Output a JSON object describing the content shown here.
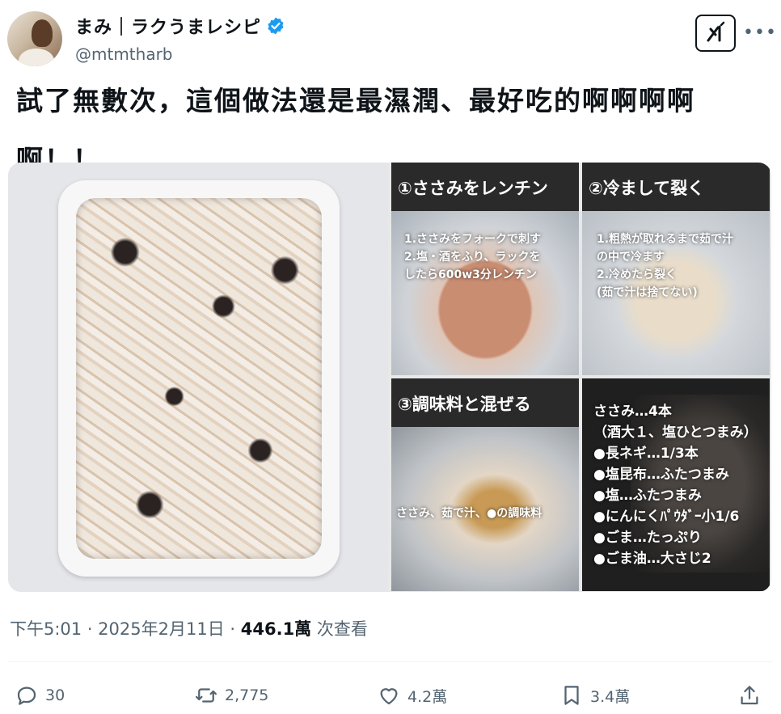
{
  "author": {
    "display_name": "まみ｜ラクうまレシピ",
    "handle": "@mtmtharb"
  },
  "tweet": {
    "text": "試了無數次，這個做法還是最濕潤、最好吃的啊啊啊啊啊！！"
  },
  "media": {
    "panels": [
      {
        "title": "①ささみをレンチン",
        "text": "1.ささみをフォークで刺す\n2.塩・酒をふり、ラックを\nしたら600w3分レンチン"
      },
      {
        "title": "②冷まして裂く",
        "text": "1.粗熱が取れるまで茹で汁\nの中で冷ます\n2.冷めたら裂く\n(茹で汁は捨てない)"
      },
      {
        "title": "③調味料と混ぜる",
        "text": "ささみ、茹で汁、●の調味料"
      },
      {
        "title": "",
        "text": "ささみ…4本\n（酒大１、塩ひとつまみ）\n●長ネギ…1/3本\n●塩昆布…ふたつまみ\n●塩…ふたつまみ\n●にんにくﾊﾟｳﾀﾞｰ小1/6\n●ごま…たっぷり\n●ごま油…大さじ2"
      }
    ]
  },
  "meta": {
    "time_date": "下午5:01 · 2025年2月11日 · ",
    "views_count": "446.1萬",
    "views_label": " 次查看"
  },
  "actions": {
    "replies": "30",
    "reposts": "2,775",
    "likes": "4.2萬",
    "bookmarks": "3.4萬"
  },
  "colors": {
    "verified": "#1d9bf0",
    "secondary_text": "#536471",
    "primary_text": "#0f1419"
  },
  "icons": [
    "verified-icon",
    "grok-icon",
    "more-icon",
    "reply-icon",
    "repost-icon",
    "like-icon",
    "bookmark-icon",
    "share-icon"
  ]
}
